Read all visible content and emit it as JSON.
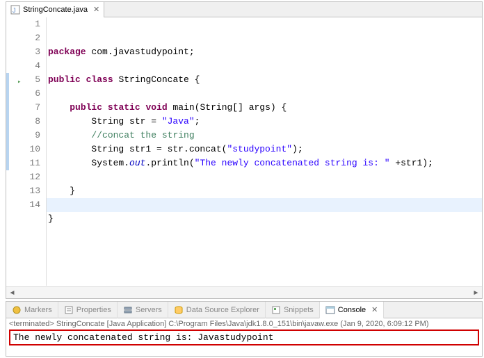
{
  "tab": {
    "filename": "StringConcate.java"
  },
  "code": {
    "lines": [
      {
        "n": 1,
        "segments": [
          {
            "t": "kw",
            "v": "package"
          },
          {
            "t": "plain",
            "v": " com.javastudypoint;"
          }
        ]
      },
      {
        "n": 2,
        "segments": []
      },
      {
        "n": 3,
        "segments": [
          {
            "t": "kw",
            "v": "public"
          },
          {
            "t": "plain",
            "v": " "
          },
          {
            "t": "kw",
            "v": "class"
          },
          {
            "t": "plain",
            "v": " StringConcate {"
          }
        ]
      },
      {
        "n": 4,
        "segments": []
      },
      {
        "n": 5,
        "segments": [
          {
            "t": "plain",
            "v": "    "
          },
          {
            "t": "kw",
            "v": "public"
          },
          {
            "t": "plain",
            "v": " "
          },
          {
            "t": "kw",
            "v": "static"
          },
          {
            "t": "plain",
            "v": " "
          },
          {
            "t": "kw",
            "v": "void"
          },
          {
            "t": "plain",
            "v": " main(String[] args) {"
          }
        ]
      },
      {
        "n": 6,
        "segments": [
          {
            "t": "plain",
            "v": "        String str = "
          },
          {
            "t": "str",
            "v": "\"Java\""
          },
          {
            "t": "plain",
            "v": ";"
          }
        ]
      },
      {
        "n": 7,
        "segments": [
          {
            "t": "plain",
            "v": "        "
          },
          {
            "t": "cmt",
            "v": "//concat the string"
          }
        ]
      },
      {
        "n": 8,
        "segments": [
          {
            "t": "plain",
            "v": "        String str1 = str.concat("
          },
          {
            "t": "str",
            "v": "\"studypoint\""
          },
          {
            "t": "plain",
            "v": ");"
          }
        ]
      },
      {
        "n": 9,
        "segments": [
          {
            "t": "plain",
            "v": "        System."
          },
          {
            "t": "static-field",
            "v": "out"
          },
          {
            "t": "plain",
            "v": ".println("
          },
          {
            "t": "str",
            "v": "\"The newly concatenated string is: \""
          },
          {
            "t": "plain",
            "v": " +str1);"
          }
        ]
      },
      {
        "n": 10,
        "segments": [
          {
            "t": "plain",
            "v": ""
          }
        ]
      },
      {
        "n": 11,
        "segments": [
          {
            "t": "plain",
            "v": "    }"
          }
        ]
      },
      {
        "n": 12,
        "segments": []
      },
      {
        "n": 13,
        "segments": [
          {
            "t": "plain",
            "v": "}"
          }
        ]
      },
      {
        "n": 14,
        "segments": []
      }
    ],
    "current_line": 14
  },
  "bottom_tabs": [
    {
      "label": "Markers",
      "icon": "markers-icon"
    },
    {
      "label": "Properties",
      "icon": "properties-icon"
    },
    {
      "label": "Servers",
      "icon": "servers-icon"
    },
    {
      "label": "Data Source Explorer",
      "icon": "datasource-icon"
    },
    {
      "label": "Snippets",
      "icon": "snippets-icon"
    },
    {
      "label": "Console",
      "icon": "console-icon",
      "active": true
    }
  ],
  "console": {
    "terminated_line": "<terminated> StringConcate [Java Application] C:\\Program Files\\Java\\jdk1.8.0_151\\bin\\javaw.exe (Jan 9, 2020, 6:09:12 PM)",
    "output": "The newly concatenated string is: Javastudypoint"
  }
}
